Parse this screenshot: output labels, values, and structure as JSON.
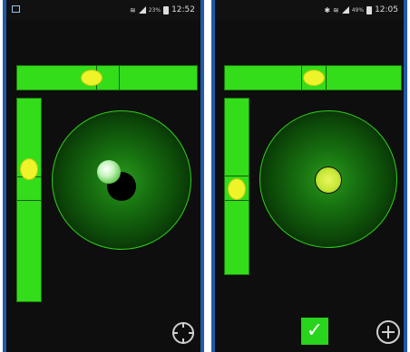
{
  "left_screen": {
    "status_bar": {
      "clock": "12:52",
      "battery": "23%"
    },
    "bottom_action": {
      "icon": "crosshair-icon"
    }
  },
  "right_screen": {
    "status_bar": {
      "clock": "12:05",
      "battery": "49%"
    },
    "bottom_actions": {
      "confirm_icon": "checkmark-icon",
      "confirm_symbol": "✓",
      "add_icon": "plus-circle-icon"
    }
  },
  "colors": {
    "level_green": "#33dd1a",
    "bubble_yellow": "#eef32a",
    "background": "#0e0e0e",
    "frame_blue": "#1f5aa8"
  }
}
